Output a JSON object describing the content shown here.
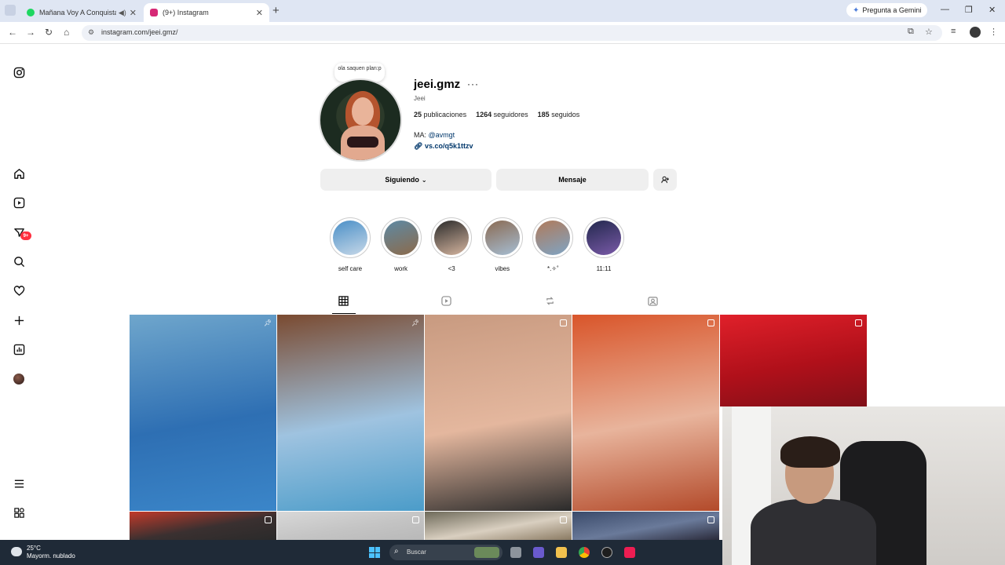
{
  "browser": {
    "tabs": [
      {
        "title": "Mañana Voy A Conquistarla",
        "favicon_color": "#1ed760",
        "active": false
      },
      {
        "title": "(9+) Instagram",
        "favicon_color": "#d62976",
        "active": true
      }
    ],
    "new_tab": "+",
    "gemini_label": "Pregunta a Gemini",
    "url": "instagram.com/jeei.gmz/"
  },
  "rail": {
    "notifications_badge": "9+"
  },
  "profile": {
    "note": "ola saquen plan:p",
    "username": "jeei.gmz",
    "more": "···",
    "full_name": "Jeei",
    "stats": {
      "posts_count": "25",
      "posts_label": "publicaciones",
      "followers_count": "1264",
      "followers_label": "seguidores",
      "following_count": "185",
      "following_label": "seguidos"
    },
    "bio_prefix": "MA:",
    "bio_mention": "@avmgt",
    "bio_link": "vs.co/q5k1ttzv",
    "buttons": {
      "following": "Siguiendo",
      "message": "Mensaje"
    }
  },
  "highlights": [
    {
      "label": "self care",
      "colors": [
        "#4a8fc7",
        "#c7d8e8"
      ]
    },
    {
      "label": "work",
      "colors": [
        "#5d8aa5",
        "#8c6a4a"
      ]
    },
    {
      "label": "<3",
      "colors": [
        "#2a2a2a",
        "#d6b6a0"
      ]
    },
    {
      "label": "vibes",
      "colors": [
        "#8a6a52",
        "#a6bed4"
      ]
    },
    {
      "label": "*.✧˚",
      "colors": [
        "#b07a5a",
        "#7fa4c4"
      ]
    },
    {
      "label": "11:11",
      "colors": [
        "#22284d",
        "#7a5aa8"
      ]
    }
  ],
  "grid": [
    {
      "colors": [
        "#6fa6cc",
        "#2e6fb3",
        "#3b86c9"
      ],
      "marker": "pin"
    },
    {
      "colors": [
        "#7a4a30",
        "#9fc3e0",
        "#4b9cc9"
      ],
      "marker": "pin"
    },
    {
      "colors": [
        "#c89a80",
        "#e4b79e",
        "#2a2a2a"
      ],
      "marker": "multi"
    },
    {
      "colors": [
        "#d9552a",
        "#e8b49c",
        "#b34a2a"
      ],
      "marker": "multi"
    },
    {
      "colors": [
        "#e0202a",
        "#b0101a",
        "#801018"
      ],
      "marker": "multi"
    },
    {
      "colors": [
        "#c23a2a",
        "#3a3030",
        "#2a2a2a"
      ],
      "marker": "multi"
    },
    {
      "colors": [
        "#d8d8d8",
        "#c4c4c4",
        "#b8b8b8"
      ],
      "marker": "multi"
    },
    {
      "colors": [
        "#6e6a5a",
        "#d9cfc0",
        "#8a7a62"
      ],
      "marker": "multi"
    },
    {
      "colors": [
        "#3a4a6a",
        "#6a7a9a",
        "#2a2a3a"
      ],
      "marker": "multi"
    }
  ],
  "taskbar": {
    "temperature": "25°C",
    "weather": "Mayorm. nublado",
    "search_placeholder": "Buscar"
  }
}
